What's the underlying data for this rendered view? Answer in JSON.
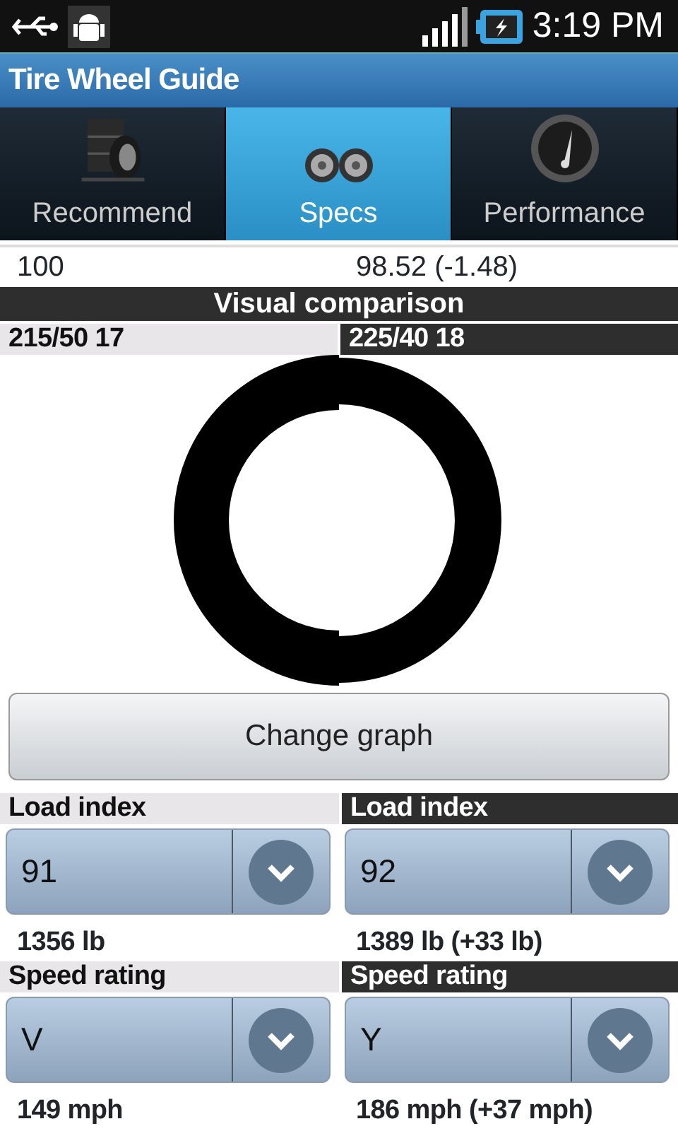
{
  "status_bar": {
    "time": "3:19 PM"
  },
  "window": {
    "title": "Tire Wheel Guide"
  },
  "tabs": [
    {
      "label": "Recommend",
      "selected": false,
      "kind": "tires"
    },
    {
      "label": "Specs",
      "selected": true,
      "kind": "wheels"
    },
    {
      "label": "Performance",
      "selected": false,
      "kind": "gauge"
    }
  ],
  "top_row": [
    "100",
    "98.52 (-1.48)"
  ],
  "visual_comparison": {
    "title": "Visual comparison",
    "sizes": [
      "215/50 17",
      "225/40 18"
    ]
  },
  "button": "Change graph",
  "sections": [
    {
      "columns": [
        {
          "label": "Load index",
          "value": "91",
          "detail": "1356 lb"
        },
        {
          "label": "Load index",
          "value": "92",
          "detail": "1389 lb (+33 lb)"
        }
      ]
    },
    {
      "columns": [
        {
          "label": "Speed rating",
          "value": "V",
          "detail": "149 mph"
        },
        {
          "label": "Speed rating",
          "value": "Y",
          "detail": "186 mph (+37 mph)"
        }
      ]
    }
  ]
}
